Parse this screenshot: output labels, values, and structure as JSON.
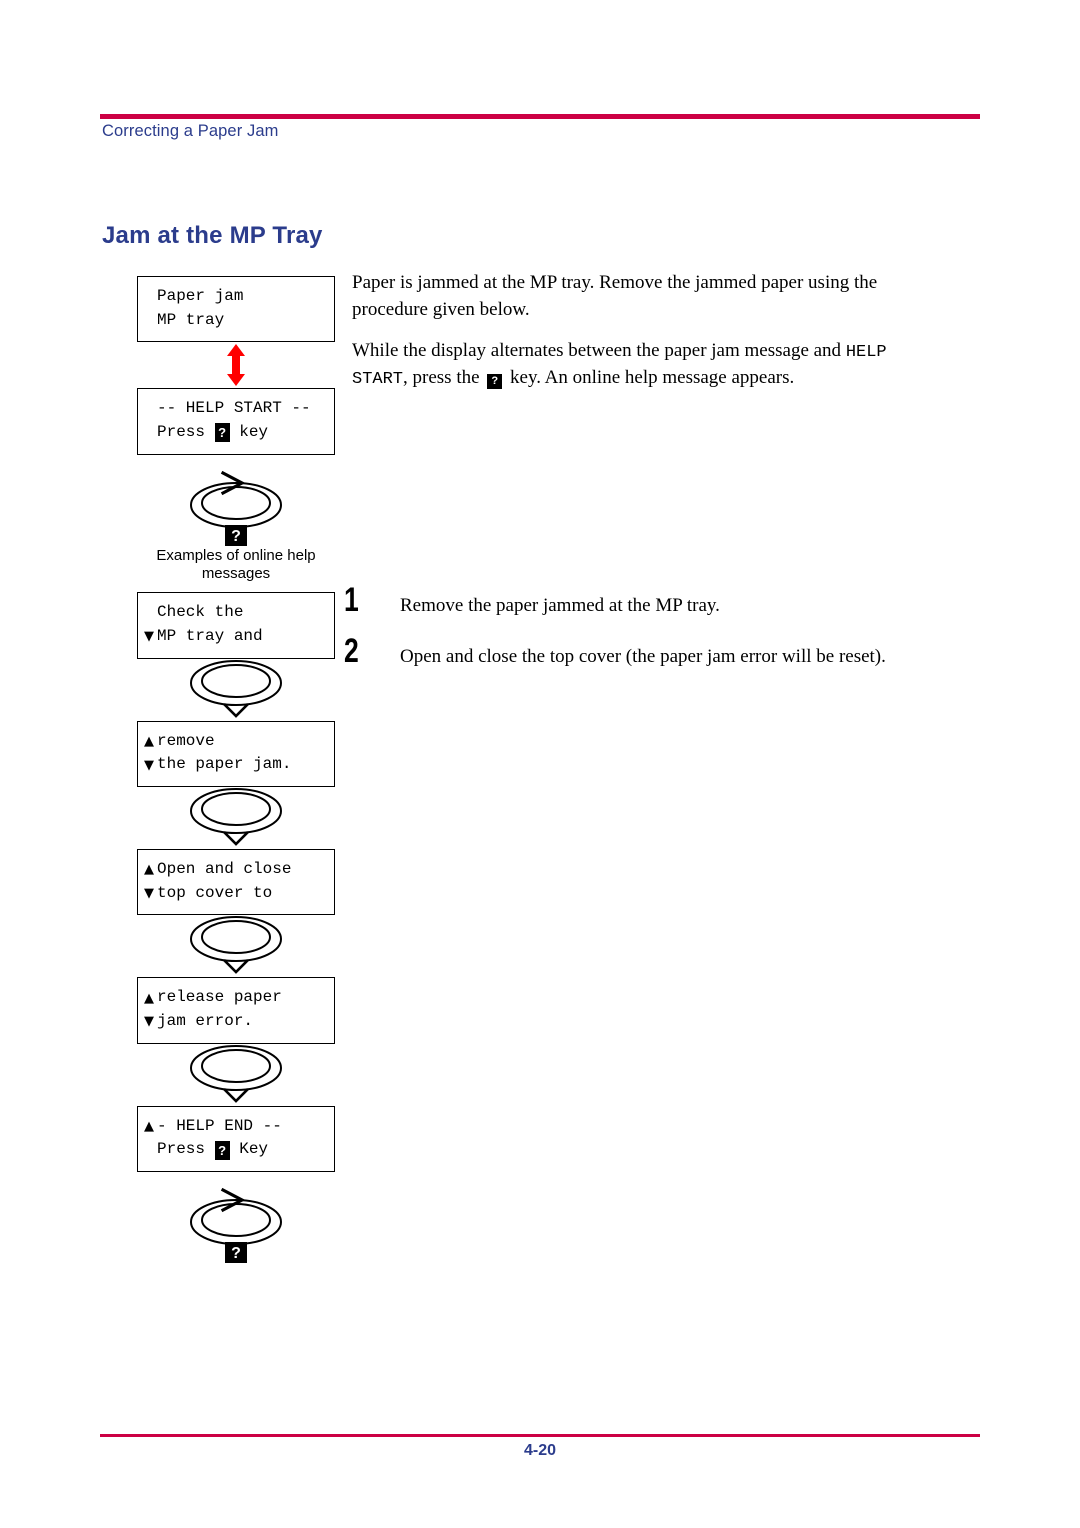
{
  "header": {
    "running_head": "Correcting a Paper Jam",
    "rule_color": "#CC0044",
    "text_color": "#2B3C8C"
  },
  "section": {
    "title": "Jam at the MP Tray"
  },
  "footer": {
    "page_number": "4-20",
    "rule_color": "#CC0044"
  },
  "body": {
    "paragraph_1": "Paper is jammed at the MP tray. Remove the jammed paper using the procedure given below.",
    "paragraph_2_part_1": "While the display alternates between the paper jam message and ",
    "paragraph_2_mono_1": "HELP START",
    "paragraph_2_part_2": ", press the ",
    "paragraph_2_key": "?",
    "paragraph_2_part_3": " key. An online help message appears."
  },
  "steps": [
    {
      "number": "1",
      "text": "Remove the paper jammed at the MP tray."
    },
    {
      "number": "2",
      "text": "Open and close the top cover (the paper jam error will be reset)."
    }
  ],
  "flow": {
    "caption": "Examples of online help messages",
    "arrow_color": "#FF0000",
    "display_1": {
      "line1_marker": "",
      "line1_text": "Paper jam",
      "line2_marker": "",
      "line2_text": "MP tray"
    },
    "display_2": {
      "line1_marker": "",
      "line1_text": "-- HELP START --",
      "line2_prefix": "Press ",
      "line2_key": "?",
      "line2_suffix": " key"
    },
    "display_3": {
      "line1_marker": "",
      "line1_text": "Check the",
      "line2_marker": "▼",
      "line2_text": "MP tray and"
    },
    "display_4": {
      "line1_marker": "▲",
      "line1_text": "remove",
      "line2_marker": "▼",
      "line2_text": "the paper jam."
    },
    "display_5": {
      "line1_marker": "▲",
      "line1_text": "Open and close",
      "line2_marker": "▼",
      "line2_text": "top cover to"
    },
    "display_6": {
      "line1_marker": "▲",
      "line1_text": "release paper",
      "line2_marker": "▼",
      "line2_text": "jam error."
    },
    "display_7": {
      "line1_marker": "▲",
      "line1_text": "- HELP END --",
      "line2_prefix": "Press ",
      "line2_key": "?",
      "line2_suffix": " Key"
    },
    "key_button": {
      "label": "?",
      "chevron": ">"
    }
  }
}
